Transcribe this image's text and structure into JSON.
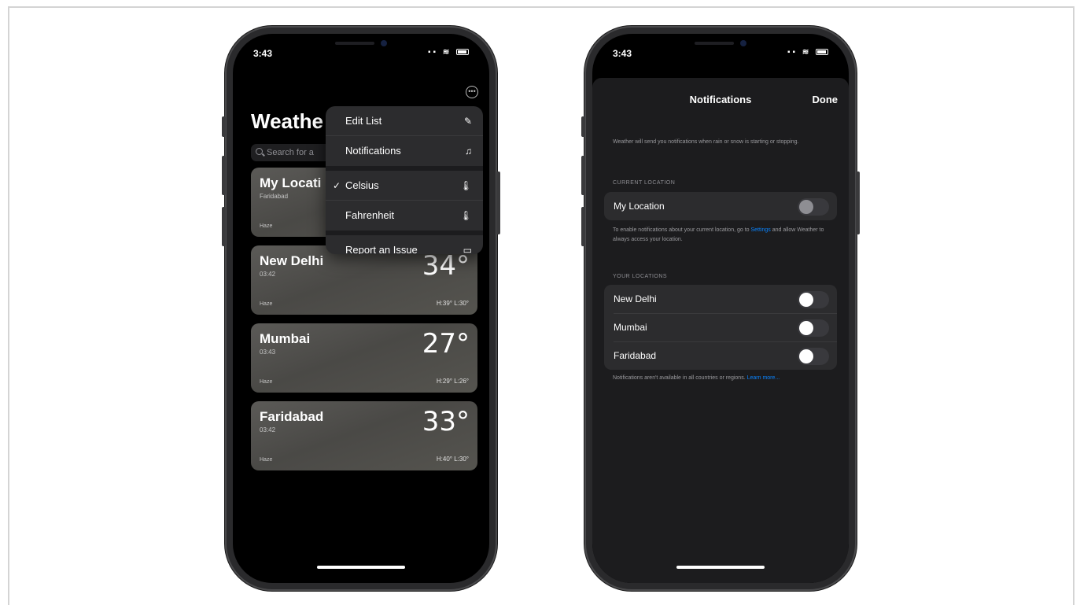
{
  "left_phone": {
    "time": "3:43",
    "app_title": "Weathe",
    "search_placeholder": "Search for a",
    "cards": [
      {
        "city": "My Locati",
        "subtitle": "Faridabad",
        "condition": "Haze",
        "temp": "",
        "hl": ""
      },
      {
        "city": "New Delhi",
        "subtitle": "03:42",
        "condition": "Haze",
        "temp": "34°",
        "hl": "H:39° L:30°"
      },
      {
        "city": "Mumbai",
        "subtitle": "03:43",
        "condition": "Haze",
        "temp": "27°",
        "hl": "H:29° L:26°"
      },
      {
        "city": "Faridabad",
        "subtitle": "03:42",
        "condition": "Haze",
        "temp": "33°",
        "hl": "H:40° L:30°"
      }
    ],
    "menu": {
      "items": [
        {
          "label": "Edit List",
          "icon": "pencil-icon"
        },
        {
          "label": "Notifications",
          "icon": "bell-icon"
        },
        {
          "label": "Celsius",
          "icon": "thermometer-icon",
          "checked": true
        },
        {
          "label": "Fahrenheit",
          "icon": "thermometer-icon"
        },
        {
          "label": "Report an Issue",
          "icon": "speech-bubble-icon"
        }
      ]
    }
  },
  "right_phone": {
    "time": "3:43",
    "title": "Notifications",
    "done_label": "Done",
    "intro": "Weather will send you notifications when rain or snow is starting or stopping.",
    "current_header": "CURRENT LOCATION",
    "my_location_label": "My Location",
    "location_hint_pre": "To enable notifications about your current location, go to ",
    "location_hint_link": "Settings",
    "location_hint_post": " and allow Weather to always access your location.",
    "your_header": "YOUR LOCATIONS",
    "locations": [
      {
        "label": "New Delhi",
        "on": false
      },
      {
        "label": "Mumbai",
        "on": false
      },
      {
        "label": "Faridabad",
        "on": false
      }
    ],
    "footer_pre": "Notifications aren't available in all countries or regions. ",
    "footer_link": "Learn more...",
    "accent_color": "#0a84ff"
  }
}
